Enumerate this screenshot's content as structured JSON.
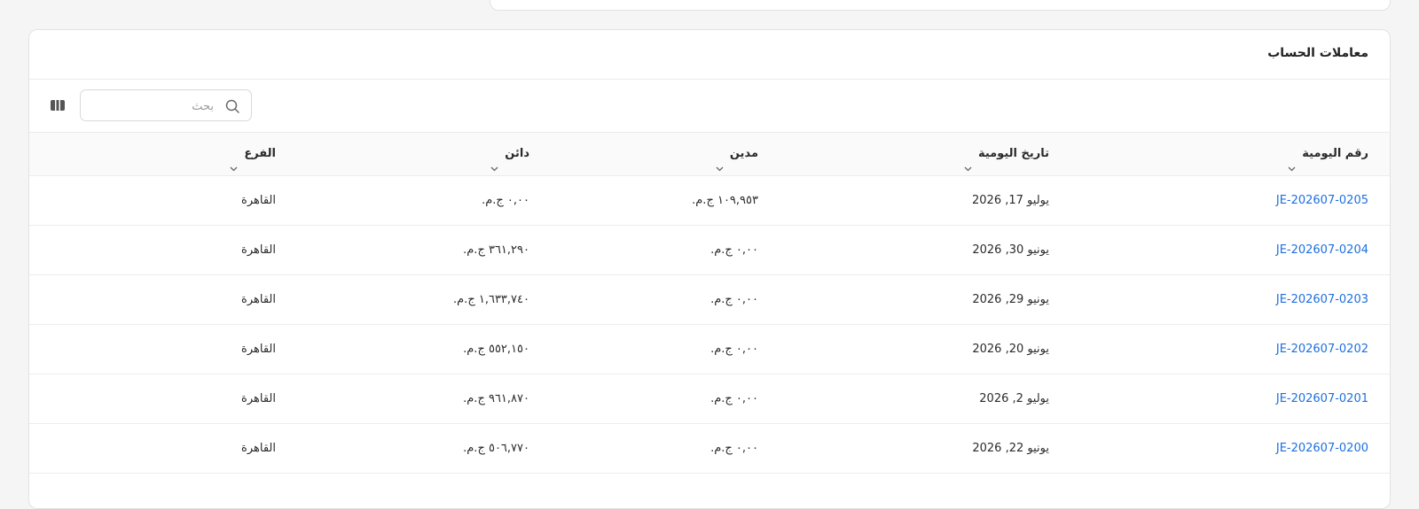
{
  "section": {
    "title": "معاملات الحساب"
  },
  "toolbar": {
    "search_placeholder": "بحث"
  },
  "table": {
    "columns": [
      "رقم اليومية",
      "تاريخ اليومية",
      "مدين",
      "دائن",
      "الفرع"
    ],
    "rows": [
      {
        "id": "JE-202607-0205",
        "date": "يوليو 17, 2026",
        "debit": "١٠٩,٩٥٣ ج.م.",
        "credit": "٠,٠٠ ج.م.",
        "branch": "القاهرة"
      },
      {
        "id": "JE-202607-0204",
        "date": "يونيو 30, 2026",
        "debit": "٠,٠٠ ج.م.",
        "credit": "٣٦١,٢٩٠ ج.م.",
        "branch": "القاهرة"
      },
      {
        "id": "JE-202607-0203",
        "date": "يونيو 29, 2026",
        "debit": "٠,٠٠ ج.م.",
        "credit": "١,٦٣٣,٧٤٠ ج.م.",
        "branch": "القاهرة"
      },
      {
        "id": "JE-202607-0202",
        "date": "يونيو 20, 2026",
        "debit": "٠,٠٠ ج.م.",
        "credit": "٥٥٢,١٥٠ ج.م.",
        "branch": "القاهرة"
      },
      {
        "id": "JE-202607-0201",
        "date": "يوليو 2, 2026",
        "debit": "٠,٠٠ ج.م.",
        "credit": "٩٦١,٨٧٠ ج.م.",
        "branch": "القاهرة"
      },
      {
        "id": "JE-202607-0200",
        "date": "يونيو 22, 2026",
        "debit": "٠,٠٠ ج.م.",
        "credit": "٥٠٦,٧٧٠ ج.م.",
        "branch": "القاهرة"
      }
    ]
  },
  "colors": {
    "link": "#1d6fe0",
    "border": "#ececec",
    "header_bg": "#fafafa"
  },
  "icons": {
    "search": "search-icon",
    "columns": "columns-icon",
    "sort": "chevron-down-icon"
  }
}
